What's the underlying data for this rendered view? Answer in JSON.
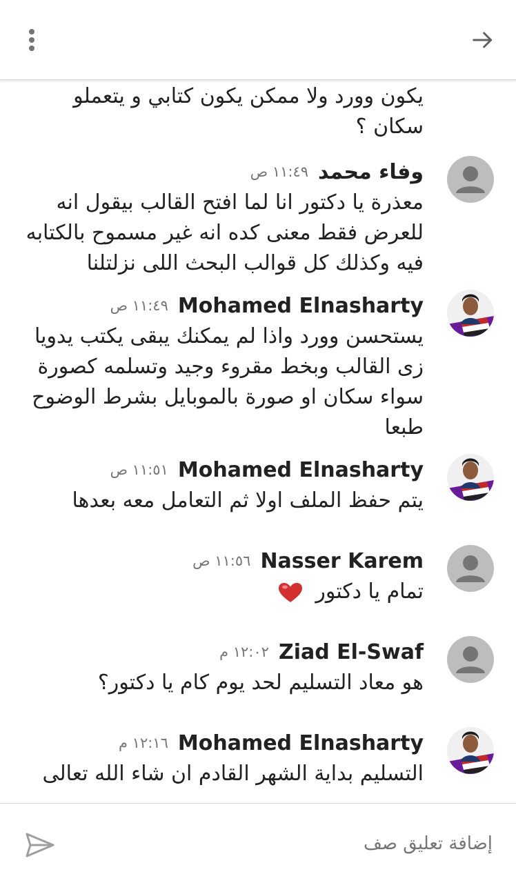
{
  "header": {
    "more_icon": "more-vert-icon",
    "back_icon": "arrow-forward-icon"
  },
  "partial_comment": {
    "text": "يكون وورد ولا ممكن يكون كتابي و يتعملو سكان ؟"
  },
  "comments": [
    {
      "author": "وفاء محمد",
      "time": "١١:٤٩ ص",
      "avatar": "default",
      "text": "معذرة يا دكتور انا لما افتح القالب بيقول انه للعرض فقط معنى كده انه غير مسموح بالكتابه فيه وكذلك كل قوالب البحث اللى نزلتلنا"
    },
    {
      "author": "Mohamed Elnasharty",
      "time": "١١:٤٩ ص",
      "avatar": "photo",
      "text": "يستحسن وورد واذا لم يمكنك يبقى يكتب يدويا زى القالب وبخط مقروء وجيد وتسلمه كصورة سواء سكان او صورة بالموبايل بشرط الوضوح طبعا"
    },
    {
      "author": "Mohamed Elnasharty",
      "time": "١١:٥١ ص",
      "avatar": "photo",
      "text": "يتم حفظ الملف اولا ثم التعامل معه بعدها"
    },
    {
      "author": "Nasser Karem",
      "time": "١١:٥٦ ص",
      "avatar": "default",
      "text": "تمام يا دكتور",
      "emoji": "heart-icon"
    },
    {
      "author": "Ziad El-Swaf",
      "time": "١٢:٠٢ م",
      "avatar": "default",
      "text": "هو معاد التسليم لحد يوم كام يا دكتور؟"
    },
    {
      "author": "Mohamed Elnasharty",
      "time": "١٢:١٦ م",
      "avatar": "photo",
      "text": "التسليم بداية الشهر القادم ان شاء الله تعالى"
    }
  ],
  "composer": {
    "placeholder": "إضافة تعليق صف",
    "send_icon": "send-icon"
  },
  "colors": {
    "text": "#212121",
    "secondary": "#757575",
    "avatar_default": "#bdbdbd",
    "divider": "#d6d6d6",
    "heart": "#d32f2f"
  }
}
